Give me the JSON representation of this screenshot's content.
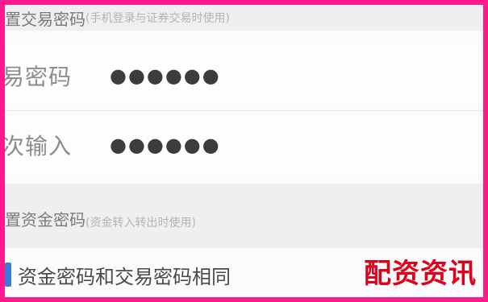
{
  "trade_password_section": {
    "title": "置交易密码",
    "hint": "(手机登录与证券交易时使用)"
  },
  "trade_password_row": {
    "label": "易密码",
    "value": "●●●●●●"
  },
  "confirm_row": {
    "label": "次输入",
    "value": "●●●●●●"
  },
  "fund_password_section": {
    "title": "置资金密码",
    "hint": "(资金转入转出时使用)"
  },
  "same_password_checkbox": {
    "label": "资金密码和交易密码相同",
    "checked": true
  },
  "watermark": {
    "text": "配资资讯"
  },
  "colors": {
    "border": "#ff1a8c",
    "watermark": "#e0001a",
    "checkbox": "#3a7bd5"
  }
}
